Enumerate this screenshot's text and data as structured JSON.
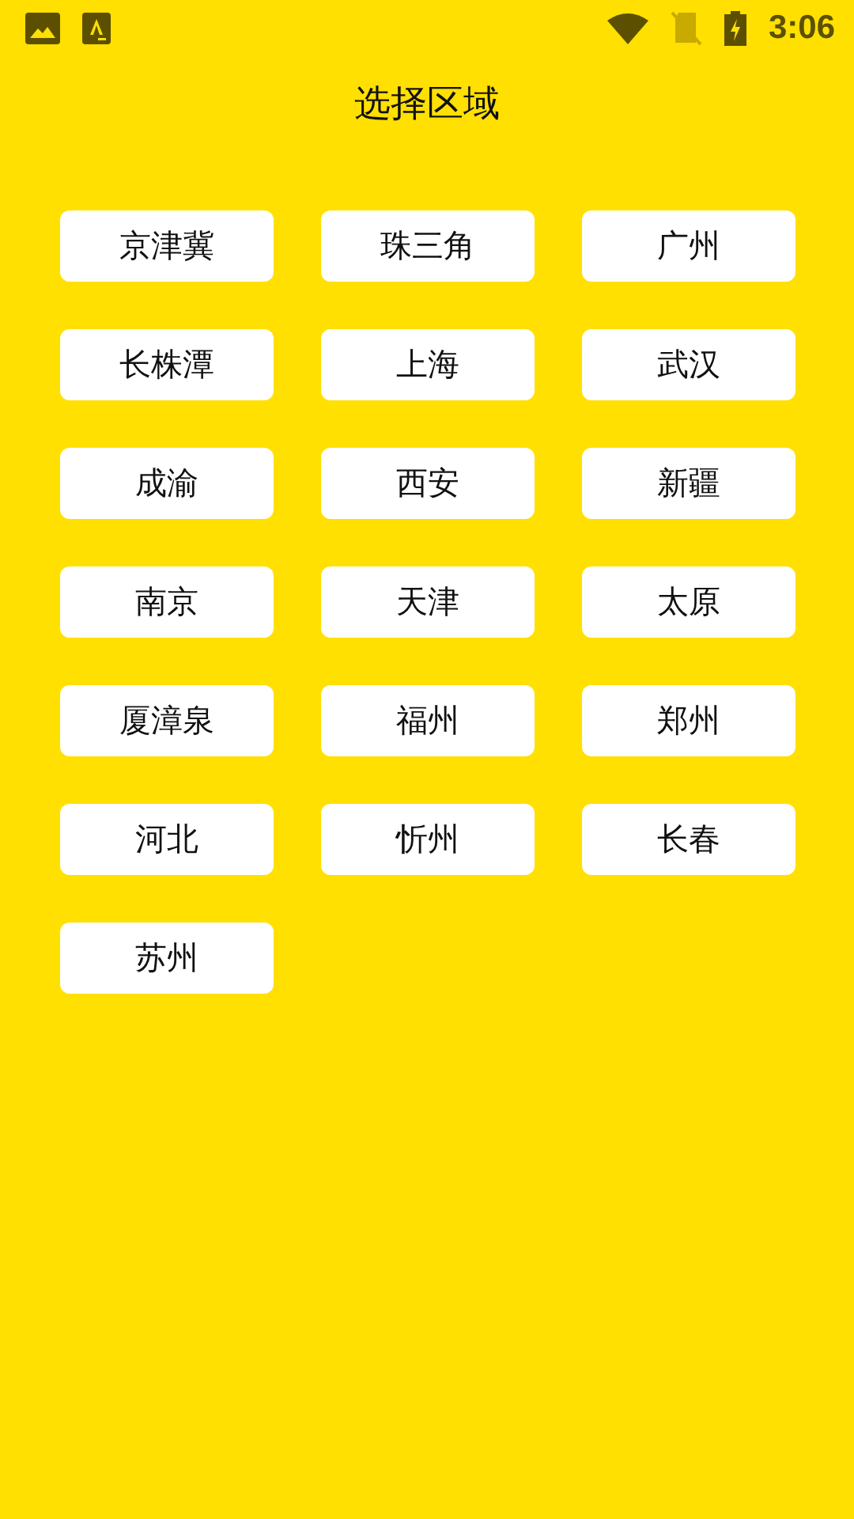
{
  "status_bar": {
    "time": "3:06"
  },
  "title": "选择区域",
  "regions": [
    "京津冀",
    "珠三角",
    "广州",
    "长株潭",
    "上海",
    "武汉",
    "成渝",
    "西安",
    "新疆",
    "南京",
    "天津",
    "太原",
    "厦漳泉",
    "福州",
    "郑州",
    "河北",
    "忻州",
    "长春",
    "苏州"
  ]
}
